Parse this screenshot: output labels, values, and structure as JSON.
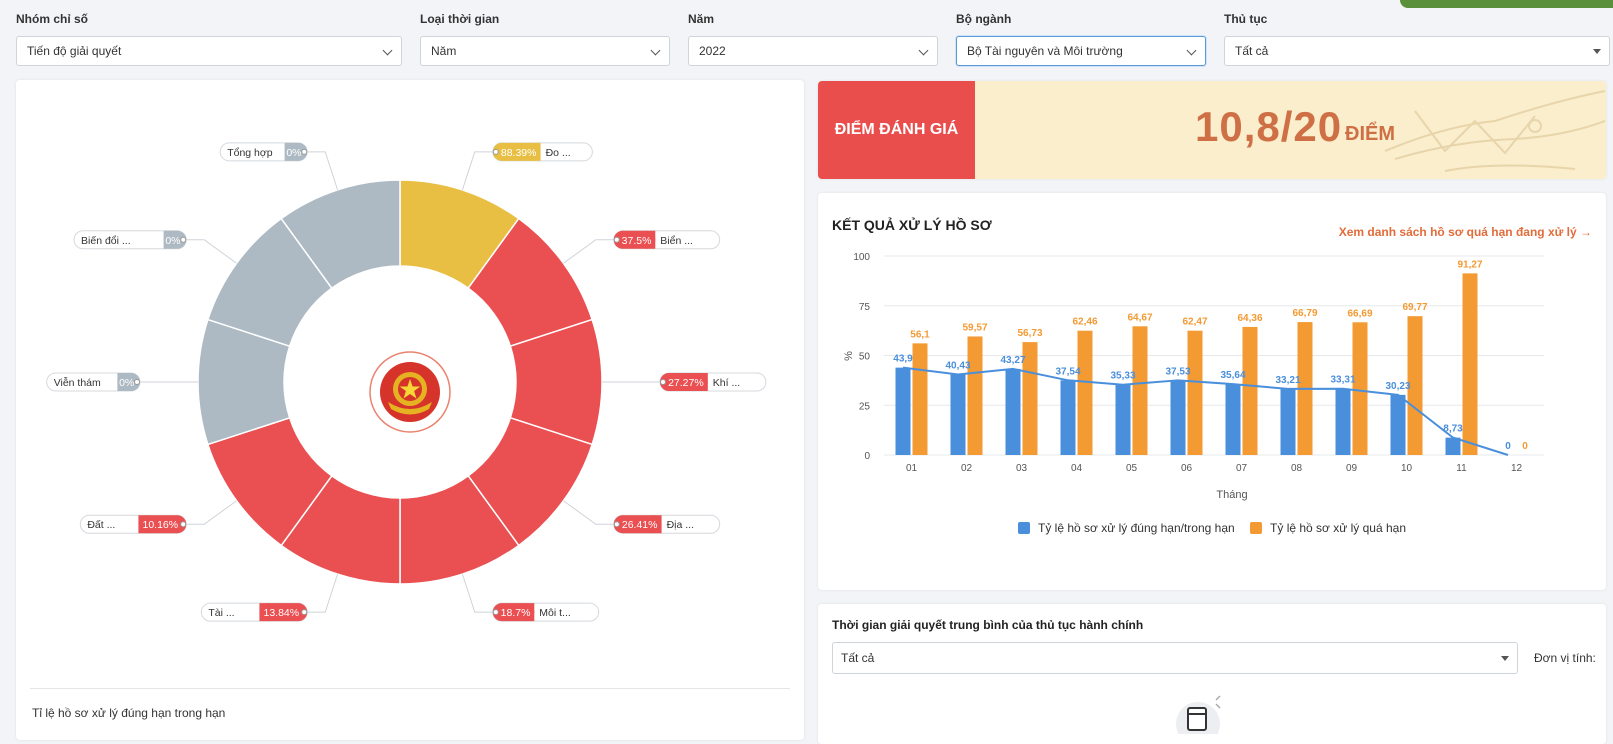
{
  "filters": [
    {
      "label": "Nhóm chỉ số",
      "value": "Tiến độ giải quyết"
    },
    {
      "label": "Loại thời gian",
      "value": "Năm"
    },
    {
      "label": "Năm",
      "value": "2022"
    },
    {
      "label": "Bộ ngành",
      "value": "Bộ Tài nguyên và Môi trường"
    },
    {
      "label": "Thủ tục",
      "value": "Tất cả"
    }
  ],
  "donut": {
    "segments": [
      {
        "label": "Đo ...",
        "pct": "88.39%",
        "color": "#e9bf43"
      },
      {
        "label": "Biển ...",
        "pct": "37.5%",
        "color": "#ea4f51"
      },
      {
        "label": "Khí ...",
        "pct": "27.27%",
        "color": "#ea4f51"
      },
      {
        "label": "Địa ...",
        "pct": "26.41%",
        "color": "#ea4f51"
      },
      {
        "label": "Môi t...",
        "pct": "18.7%",
        "color": "#ea4f51"
      },
      {
        "label": "Tài ...",
        "pct": "13.84%",
        "color": "#ea4f51"
      },
      {
        "label": "Đất ...",
        "pct": "10.16%",
        "color": "#ea4f51"
      },
      {
        "label": "Viễn thám",
        "pct": "0%",
        "color": "#adbac3"
      },
      {
        "label": "Biến đổi ...",
        "pct": "0%",
        "color": "#adbac3"
      },
      {
        "label": "Tổng hợp",
        "pct": "0%",
        "color": "#adbac3"
      }
    ],
    "footer": "Tỉ lệ hồ sơ xử lý đúng hạn trong hạn"
  },
  "score": {
    "label": "ĐIỂM ĐÁNH GIÁ",
    "value": "10,8/20",
    "unit": "ĐIỂM"
  },
  "results": {
    "title": "KẾT QUẢ XỬ LÝ HỒ SƠ",
    "link": "Xem danh sách hồ sơ quá hạn đang xử lý →"
  },
  "chart_data": {
    "type": "bar",
    "categories": [
      "01",
      "02",
      "03",
      "04",
      "05",
      "06",
      "07",
      "08",
      "09",
      "10",
      "11",
      "12"
    ],
    "series": [
      {
        "name": "Tỷ lệ hồ sơ xử lý đúng hạn/trong hạn",
        "color": "#4a8fdb",
        "values": [
          43.9,
          40.43,
          43.27,
          37.54,
          35.33,
          37.53,
          35.64,
          33.21,
          33.31,
          30.23,
          8.73,
          0
        ],
        "labels": [
          "43,9",
          "40,43",
          "43,27",
          "37,54",
          "35,33",
          "37,53",
          "35,64",
          "33,21",
          "33,31",
          "30,23",
          "8,73",
          "0"
        ]
      },
      {
        "name": "Tỷ lệ hồ sơ xử lý quá hạn",
        "color": "#f39a33",
        "values": [
          56.1,
          59.57,
          56.73,
          62.46,
          64.67,
          62.47,
          64.36,
          66.79,
          66.69,
          69.77,
          91.27,
          0
        ],
        "labels": [
          "56,1",
          "59,57",
          "56,73",
          "62,46",
          "64,67",
          "62,47",
          "64,36",
          "66,79",
          "66,69",
          "69,77",
          "91,27",
          "0"
        ]
      }
    ],
    "line_series": "Tỷ lệ hồ sơ xử lý đúng hạn/trong hạn",
    "xlabel": "Tháng",
    "ylabel": "%",
    "ylim": [
      0,
      100
    ],
    "yticks": [
      0,
      25,
      50,
      75,
      100
    ],
    "grid": true,
    "legend": "bottom"
  },
  "avg_time": {
    "title": "Thời gian giải quyết trung bình của thủ tục hành chính",
    "select_value": "Tất cả",
    "unit_label": "Đơn vị tính:"
  }
}
